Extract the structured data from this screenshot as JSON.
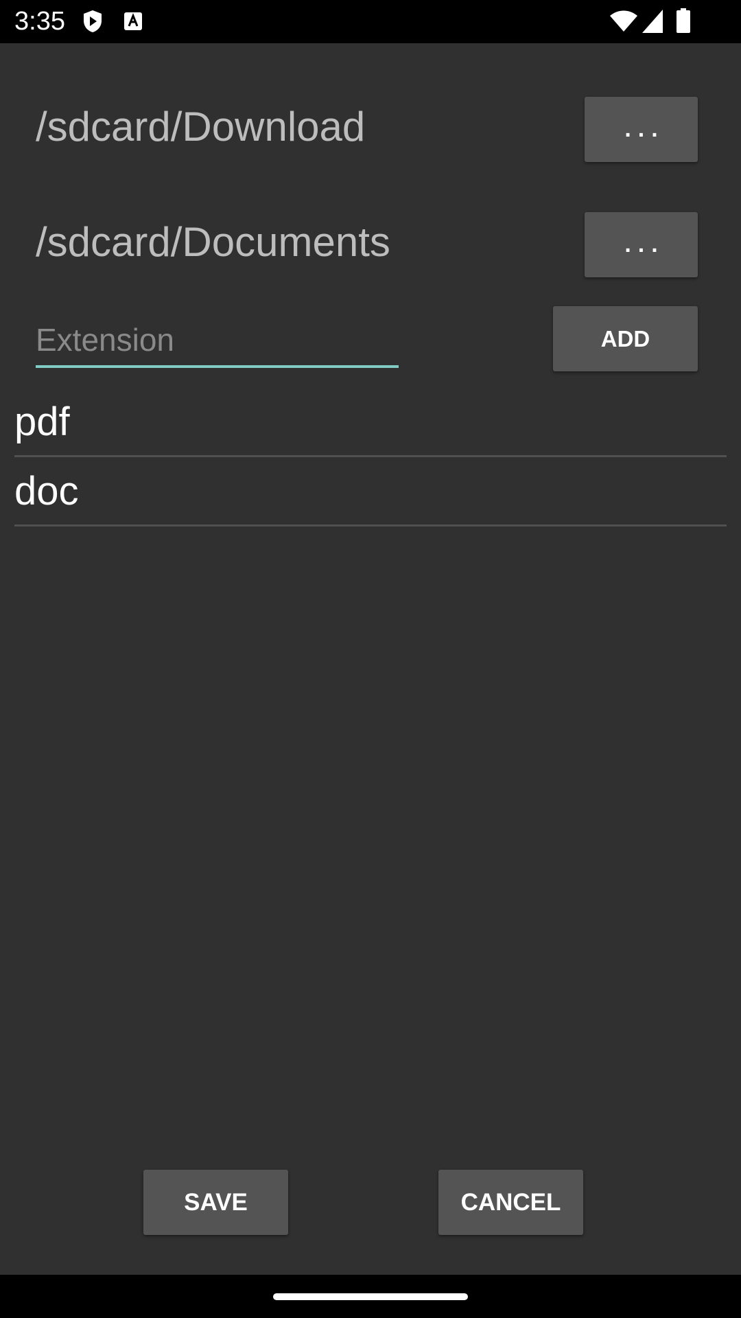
{
  "status_bar": {
    "time": "3:35",
    "icons": [
      "shield-play-icon",
      "text-a-icon",
      "wifi-icon",
      "signal-icon",
      "battery-icon"
    ]
  },
  "paths": [
    {
      "label": "/sdcard/Download",
      "button_label": "..."
    },
    {
      "label": "/sdcard/Documents",
      "button_label": "..."
    }
  ],
  "extension_input": {
    "placeholder": "Extension",
    "value": ""
  },
  "add_button": {
    "label": "ADD"
  },
  "extensions": [
    {
      "label": "pdf"
    },
    {
      "label": "doc"
    }
  ],
  "footer": {
    "save_label": "SAVE",
    "cancel_label": "CANCEL"
  },
  "colors": {
    "background": "#303030",
    "button": "#545455",
    "accent": "#80cbc4",
    "path_text": "#bdbdbd"
  }
}
